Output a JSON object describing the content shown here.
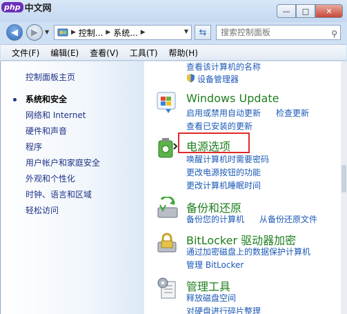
{
  "watermark": {
    "badge": "php",
    "text": "中文网"
  },
  "window_buttons": {
    "minimize": "—",
    "maximize": "□",
    "close": "✕"
  },
  "nav": {
    "back_icon": "arrow-left-icon",
    "forward_icon": "arrow-right-icon",
    "breadcrumb": [
      "控制...",
      "系统..."
    ],
    "search_placeholder": "搜索控制面板"
  },
  "menu": [
    "文件(F)",
    "编辑(E)",
    "查看(V)",
    "工具(T)",
    "帮助(H)"
  ],
  "sidebar": {
    "home": "控制面板主页",
    "items": [
      {
        "label": "系统和安全",
        "active": true
      },
      {
        "label": "网络和 Internet",
        "active": false
      },
      {
        "label": "硬件和声音",
        "active": false
      },
      {
        "label": "程序",
        "active": false
      },
      {
        "label": "用户帐户和家庭安全",
        "active": false
      },
      {
        "label": "外观和个性化",
        "active": false
      },
      {
        "label": "时钟、语言和区域",
        "active": false
      },
      {
        "label": "轻松访问",
        "active": false
      }
    ]
  },
  "main": {
    "top_links": [
      "查看该计算机的名称",
      "设备管理器"
    ],
    "windows_update": {
      "title": "Windows Update",
      "links": [
        "启用或禁用自动更新",
        "检查更新",
        "查看已安装的更新"
      ]
    },
    "power": {
      "title": "电源选项",
      "links": [
        "唤醒计算机时需要密码",
        "更改电源按钮的功能",
        "更改计算机睡眠时间"
      ]
    },
    "backup": {
      "title": "备份和还原",
      "links": [
        "备份您的计算机",
        "从备份还原文件"
      ]
    },
    "bitlocker": {
      "title": "BitLocker 驱动器加密",
      "links": [
        "通过加密磁盘上的数据保护计算机",
        "管理 BitLocker"
      ]
    },
    "admin_tools": {
      "title": "管理工具",
      "links": [
        "释放磁盘空间",
        "对硬盘进行碎片整理"
      ]
    }
  },
  "colors": {
    "heading": "#1e7e1e",
    "link": "#1b59b7",
    "highlight": "#e02828"
  }
}
